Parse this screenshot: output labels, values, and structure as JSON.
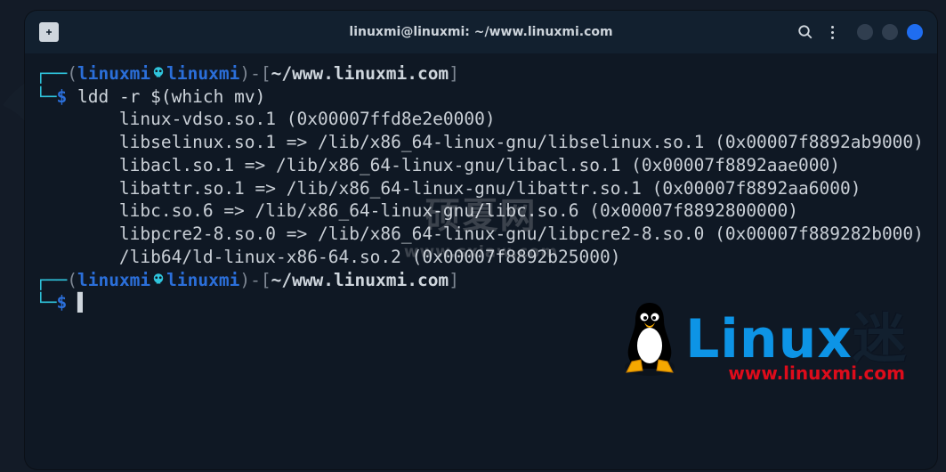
{
  "window": {
    "title": "linuxmi@linuxmi: ~/www.linuxmi.com"
  },
  "prompt": {
    "user": "linuxmi",
    "host": "linuxmi",
    "path": "~/www.linuxmi.com",
    "symbol": "$"
  },
  "command": "ldd -r $(which mv)",
  "output": [
    "        linux-vdso.so.1 (0x00007ffd8e2e0000)",
    "        libselinux.so.1 => /lib/x86_64-linux-gnu/libselinux.so.1 (0x00007f8892ab9000)",
    "        libacl.so.1 => /lib/x86_64-linux-gnu/libacl.so.1 (0x00007f8892aae000)",
    "        libattr.so.1 => /lib/x86_64-linux-gnu/libattr.so.1 (0x00007f8892aa6000)",
    "        libc.so.6 => /lib/x86_64-linux-gnu/libc.so.6 (0x00007f8892800000)",
    "        libpcre2-8.so.0 => /lib/x86_64-linux-gnu/libpcre2-8.so.0 (0x00007f889282b000)",
    "        /lib64/ld-linux-x86-64.so.2 (0x00007f8892b25000)"
  ],
  "watermarks": {
    "top_line1": "硕夏网",
    "top_line2": "www.sxiaw.com",
    "logo_text": "Linux迷",
    "logo_url": "www.linuxmi.com"
  }
}
